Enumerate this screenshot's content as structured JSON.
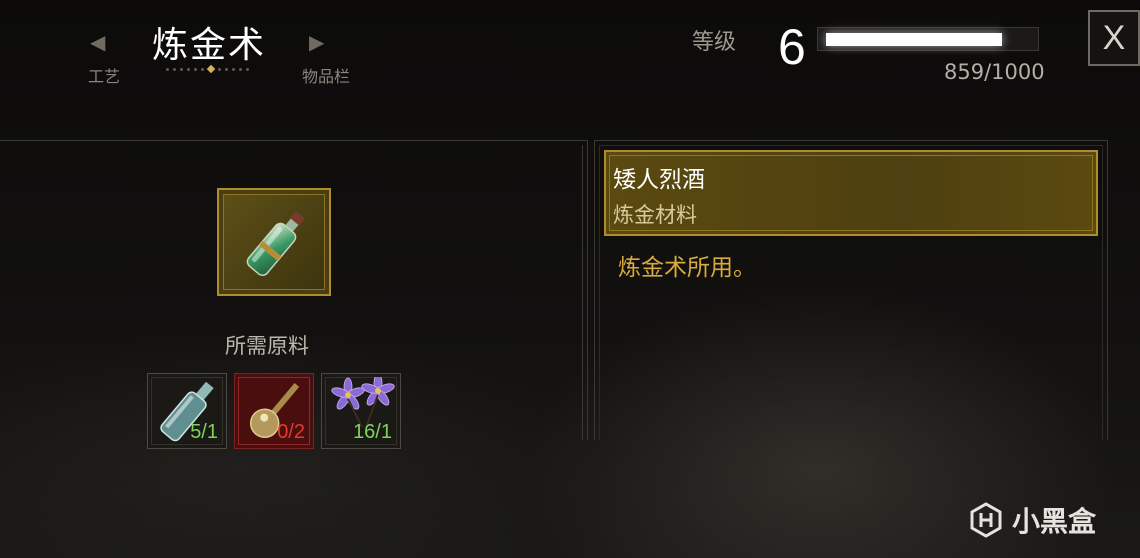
{
  "header": {
    "title": "炼金术",
    "prev_tab": "工艺",
    "next_tab": "物品栏",
    "prev_arrow": "◀",
    "next_arrow": "▶",
    "page_dot_count": 12,
    "active_dot_index": 6
  },
  "level": {
    "label": "等级",
    "value": "6",
    "xp_text": "859/1000",
    "xp_fraction": 0.859
  },
  "close_label": "X",
  "crafted_item": {
    "icon": "potion-bottle-icon"
  },
  "requirements": {
    "label": "所需原料",
    "ingredients": [
      {
        "icon": "empty-bottle-icon",
        "count": "5/1",
        "sufficient": true
      },
      {
        "icon": "mace-ingredient-icon",
        "count": "0/2",
        "sufficient": false
      },
      {
        "icon": "purple-flower-icon",
        "count": "16/1",
        "sufficient": true
      }
    ]
  },
  "details": {
    "name": "矮人烈酒",
    "type": "炼金材料",
    "description": "炼金术所用。"
  },
  "watermark": {
    "text": "小黑盒",
    "icon": "xiaoheihe-logo-icon"
  },
  "colors": {
    "gold": "#b08d2b",
    "description_text": "#d7ab3c",
    "sufficient": "#7fd25c",
    "insufficient": "#e23b2e"
  }
}
